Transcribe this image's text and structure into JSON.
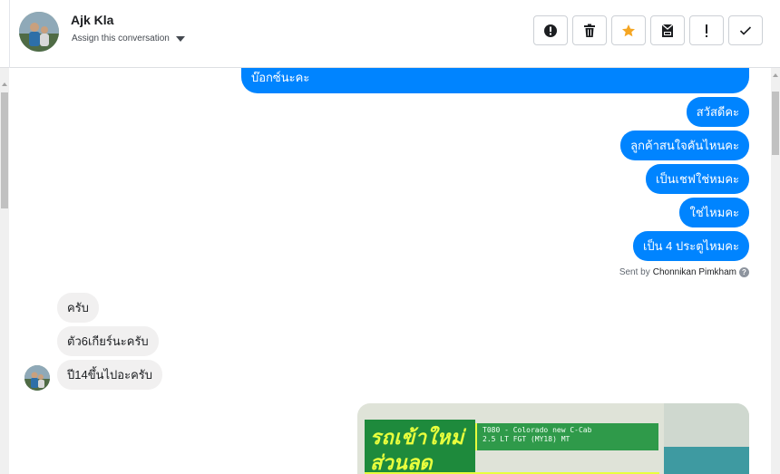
{
  "header": {
    "contact_name": "Ajk Kla",
    "assign_label": "Assign this conversation",
    "actions": [
      {
        "icon": "alert-circle-icon",
        "label": "Mark as spam"
      },
      {
        "icon": "trash-icon",
        "label": "Delete"
      },
      {
        "icon": "star-icon",
        "label": "Star",
        "color": "#f5a623"
      },
      {
        "icon": "archive-icon",
        "label": "Archive"
      },
      {
        "icon": "exclamation-icon",
        "label": "Follow up"
      },
      {
        "icon": "check-icon",
        "label": "Mark as done"
      }
    ]
  },
  "thread": {
    "outgoing_color": "#0084ff",
    "incoming_color": "#f1f0f0",
    "outgoing_messages": [
      "บ๊อกซ์นะคะ",
      "สวัสดีคะ",
      "ลูกค้าสนใจคันไหนคะ",
      "เป็นเชฟใช่หมคะ",
      "ใช่ไหมคะ",
      "เป็น 4 ประตูไหมคะ"
    ],
    "sent_by_prefix": "Sent by",
    "sent_by_name": "Chonnikan Pimkham",
    "incoming_messages": [
      "ครับ",
      "ตัว6เกียร์นะครับ",
      "ปี14ขึ้นไปอะครับ"
    ],
    "promo": {
      "headline_1": "รถเข้าใหม่",
      "headline_2": "ส่วนลด",
      "spec_line_1": "T080 - Colorado new C-Cab",
      "spec_line_2": "2.5 LT FGT (MY18) MT"
    }
  }
}
